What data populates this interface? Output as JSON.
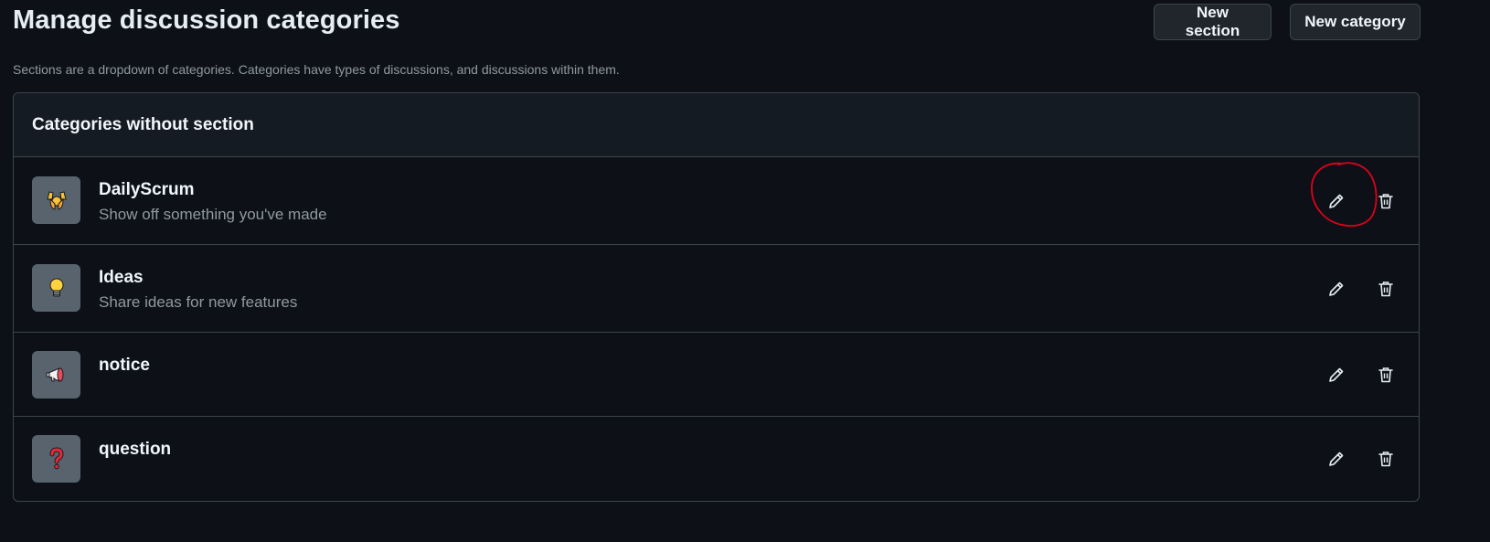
{
  "page": {
    "title": "Manage discussion categories",
    "description": "Sections are a dropdown of categories. Categories have types of discussions, and discussions within them."
  },
  "header_buttons": {
    "new_section": "New section",
    "new_category": "New category"
  },
  "section": {
    "title": "Categories without section"
  },
  "categories": [
    {
      "name": "DailyScrum",
      "description": "Show off something you've made",
      "emoji": "raising-hands"
    },
    {
      "name": "Ideas",
      "description": "Share ideas for new features",
      "emoji": "light-bulb"
    },
    {
      "name": "notice",
      "description": "",
      "emoji": "loudspeaker"
    },
    {
      "name": "question",
      "description": "",
      "emoji": "question-mark"
    }
  ],
  "icons": {
    "edit": "pencil-icon",
    "delete": "trash-icon"
  },
  "colors": {
    "background": "#0d1117",
    "header_background": "#151b23",
    "border": "#3d444d",
    "emoji_tile": "#59636e",
    "muted_text": "#9198a1",
    "annotation": "#e0001b"
  }
}
